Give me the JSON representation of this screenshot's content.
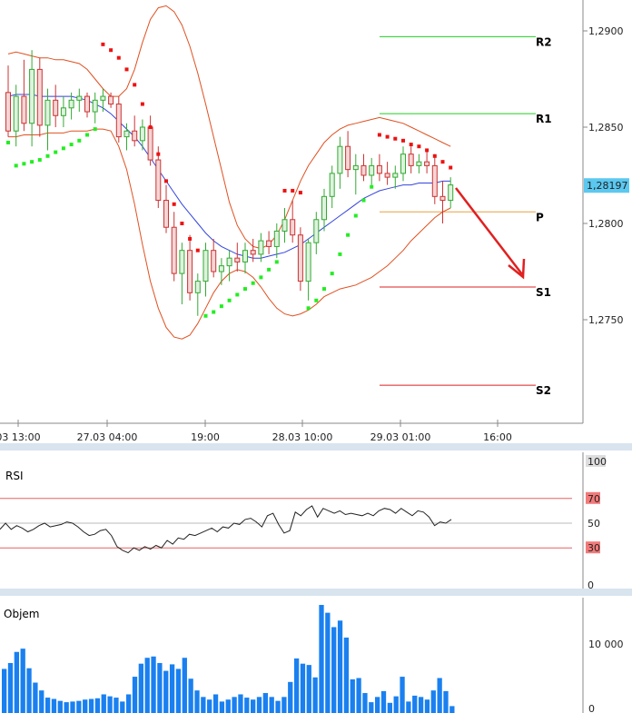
{
  "chart_data": [
    {
      "type": "candlestick",
      "x_tick_labels": [
        "03 13:00",
        "27.03 04:00",
        "19:00",
        "28.03 10:00",
        "29.03 01:00",
        "16:00"
      ],
      "y_tick_labels": [
        "1,2900",
        "1,2850",
        "1,2800",
        "1,2750"
      ],
      "ylim": [
        1.27,
        1.292
      ],
      "current_price_label": "1,28197",
      "current_price": 1.28197,
      "pivot_levels": [
        {
          "label": "R2",
          "value": 1.2897,
          "color": "#22cc22"
        },
        {
          "label": "R1",
          "value": 1.2857,
          "color": "#22cc22"
        },
        {
          "label": "P",
          "value": 1.2806,
          "color": "#e8a040"
        },
        {
          "label": "S1",
          "value": 1.2767,
          "color": "#dd2222"
        },
        {
          "label": "S2",
          "value": 1.2716,
          "color": "#dd2222"
        }
      ],
      "candles": [
        [
          1.2868,
          1.2882,
          1.2845,
          1.2848
        ],
        [
          1.2848,
          1.2872,
          1.284,
          1.2866
        ],
        [
          1.2866,
          1.2885,
          1.2848,
          1.2852
        ],
        [
          1.2852,
          1.289,
          1.284,
          1.288
        ],
        [
          1.288,
          1.2886,
          1.2845,
          1.2851
        ],
        [
          1.2851,
          1.287,
          1.2838,
          1.2864
        ],
        [
          1.2864,
          1.2872,
          1.285,
          1.2856
        ],
        [
          1.2856,
          1.2866,
          1.285,
          1.286
        ],
        [
          1.286,
          1.2868,
          1.2854,
          1.2864
        ],
        [
          1.2864,
          1.287,
          1.2858,
          1.2866
        ],
        [
          1.2866,
          1.2868,
          1.2855,
          1.2858
        ],
        [
          1.2858,
          1.2868,
          1.2852,
          1.2864
        ],
        [
          1.2864,
          1.287,
          1.2858,
          1.2866
        ],
        [
          1.2866,
          1.2868,
          1.286,
          1.2862
        ],
        [
          1.2862,
          1.2866,
          1.2842,
          1.2845
        ],
        [
          1.2845,
          1.2852,
          1.2838,
          1.2848
        ],
        [
          1.2848,
          1.2856,
          1.284,
          1.2843
        ],
        [
          1.2843,
          1.2854,
          1.2838,
          1.285
        ],
        [
          1.285,
          1.2856,
          1.283,
          1.2833
        ],
        [
          1.2833,
          1.284,
          1.2808,
          1.2812
        ],
        [
          1.2812,
          1.282,
          1.2795,
          1.2798
        ],
        [
          1.2798,
          1.2806,
          1.277,
          1.2774
        ],
        [
          1.2774,
          1.279,
          1.2758,
          1.2786
        ],
        [
          1.2786,
          1.2794,
          1.276,
          1.2764
        ],
        [
          1.2764,
          1.2774,
          1.2752,
          1.277
        ],
        [
          1.277,
          1.279,
          1.2762,
          1.2786
        ],
        [
          1.2786,
          1.2792,
          1.2772,
          1.2775
        ],
        [
          1.2775,
          1.2782,
          1.2768,
          1.2778
        ],
        [
          1.2778,
          1.2786,
          1.277,
          1.2782
        ],
        [
          1.2782,
          1.279,
          1.2775,
          1.278
        ],
        [
          1.278,
          1.279,
          1.2774,
          1.2786
        ],
        [
          1.2786,
          1.2792,
          1.278,
          1.2784
        ],
        [
          1.2784,
          1.2795,
          1.278,
          1.2791
        ],
        [
          1.2791,
          1.2796,
          1.2784,
          1.2788
        ],
        [
          1.2788,
          1.28,
          1.2782,
          1.2796
        ],
        [
          1.2796,
          1.2808,
          1.279,
          1.2802
        ],
        [
          1.2802,
          1.2812,
          1.279,
          1.2794
        ],
        [
          1.2794,
          1.2798,
          1.2765,
          1.277
        ],
        [
          1.277,
          1.2792,
          1.276,
          1.279
        ],
        [
          1.279,
          1.2806,
          1.2784,
          1.2802
        ],
        [
          1.2802,
          1.2818,
          1.2796,
          1.2814
        ],
        [
          1.2814,
          1.283,
          1.2808,
          1.2826
        ],
        [
          1.2826,
          1.2845,
          1.2818,
          1.284
        ],
        [
          1.284,
          1.2848,
          1.2824,
          1.2828
        ],
        [
          1.2828,
          1.2836,
          1.2815,
          1.283
        ],
        [
          1.283,
          1.2836,
          1.2822,
          1.2825
        ],
        [
          1.2825,
          1.2834,
          1.282,
          1.283
        ],
        [
          1.283,
          1.2836,
          1.2822,
          1.2826
        ],
        [
          1.2826,
          1.2832,
          1.282,
          1.2824
        ],
        [
          1.2824,
          1.283,
          1.2818,
          1.2826
        ],
        [
          1.2826,
          1.284,
          1.2822,
          1.2836
        ],
        [
          1.2836,
          1.284,
          1.2826,
          1.283
        ],
        [
          1.283,
          1.2836,
          1.2826,
          1.2832
        ],
        [
          1.2832,
          1.2838,
          1.2826,
          1.283
        ],
        [
          1.283,
          1.2836,
          1.281,
          1.2814
        ],
        [
          1.2814,
          1.2822,
          1.28,
          1.2812
        ],
        [
          1.2812,
          1.2824,
          1.2808,
          1.282
        ]
      ],
      "bollinger_upper": [
        1.2888,
        1.2889,
        1.2888,
        1.2887,
        1.2886,
        1.2886,
        1.2885,
        1.2885,
        1.2884,
        1.2883,
        1.288,
        1.2875,
        1.287,
        1.2866,
        1.2866,
        1.287,
        1.288,
        1.2894,
        1.2906,
        1.2912,
        1.2913,
        1.291,
        1.2903,
        1.2892,
        1.2878,
        1.2862,
        1.2845,
        1.2828,
        1.2811,
        1.2799,
        1.2792,
        1.2788,
        1.2787,
        1.2789,
        1.2794,
        1.2802,
        1.2812,
        1.2822,
        1.283,
        1.2836,
        1.2842,
        1.2846,
        1.2849,
        1.2851,
        1.2852,
        1.2853,
        1.2854,
        1.2855,
        1.2854,
        1.2853,
        1.2852,
        1.285,
        1.2848,
        1.2846,
        1.2844,
        1.2842,
        1.284
      ],
      "bollinger_mid": [
        1.2866,
        1.2867,
        1.2867,
        1.2867,
        1.2866,
        1.2866,
        1.2866,
        1.2866,
        1.2866,
        1.2865,
        1.2864,
        1.2862,
        1.286,
        1.2857,
        1.2853,
        1.2849,
        1.2845,
        1.284,
        1.2834,
        1.2828,
        1.2822,
        1.2816,
        1.281,
        1.2805,
        1.28,
        1.2795,
        1.2791,
        1.2788,
        1.2786,
        1.2784,
        1.2783,
        1.2782,
        1.2782,
        1.2783,
        1.2784,
        1.2785,
        1.2787,
        1.2789,
        1.2792,
        1.2795,
        1.2798,
        1.2801,
        1.2804,
        1.2807,
        1.281,
        1.2813,
        1.2815,
        1.2817,
        1.2818,
        1.2819,
        1.282,
        1.282,
        1.2821,
        1.2821,
        1.2821,
        1.2822,
        1.2822
      ],
      "bollinger_lower": [
        1.2845,
        1.2845,
        1.2846,
        1.2846,
        1.2846,
        1.2847,
        1.2847,
        1.2847,
        1.2848,
        1.2848,
        1.2848,
        1.2849,
        1.2849,
        1.2848,
        1.284,
        1.2828,
        1.281,
        1.2789,
        1.277,
        1.2756,
        1.2746,
        1.2741,
        1.274,
        1.2742,
        1.2748,
        1.2756,
        1.2764,
        1.277,
        1.2774,
        1.2776,
        1.2775,
        1.2772,
        1.2767,
        1.2761,
        1.2756,
        1.2753,
        1.2752,
        1.2753,
        1.2755,
        1.2758,
        1.2762,
        1.2764,
        1.2766,
        1.2767,
        1.2768,
        1.277,
        1.2772,
        1.2775,
        1.2778,
        1.2782,
        1.2786,
        1.2791,
        1.2795,
        1.2799,
        1.2803,
        1.2806,
        1.2808
      ],
      "parabolic_sar": [
        {
          "i": 0,
          "v": 1.2842,
          "side": "below"
        },
        {
          "i": 1,
          "v": 1.283,
          "side": "below"
        },
        {
          "i": 2,
          "v": 1.2831,
          "side": "below"
        },
        {
          "i": 3,
          "v": 1.2832,
          "side": "below"
        },
        {
          "i": 4,
          "v": 1.2833,
          "side": "below"
        },
        {
          "i": 5,
          "v": 1.2835,
          "side": "below"
        },
        {
          "i": 6,
          "v": 1.2837,
          "side": "below"
        },
        {
          "i": 7,
          "v": 1.2839,
          "side": "below"
        },
        {
          "i": 8,
          "v": 1.2841,
          "side": "below"
        },
        {
          "i": 9,
          "v": 1.2843,
          "side": "below"
        },
        {
          "i": 10,
          "v": 1.2846,
          "side": "below"
        },
        {
          "i": 11,
          "v": 1.2849,
          "side": "below"
        },
        {
          "i": 12,
          "v": 1.2893,
          "side": "above"
        },
        {
          "i": 13,
          "v": 1.289,
          "side": "above"
        },
        {
          "i": 14,
          "v": 1.2886,
          "side": "above"
        },
        {
          "i": 15,
          "v": 1.288,
          "side": "above"
        },
        {
          "i": 16,
          "v": 1.2872,
          "side": "above"
        },
        {
          "i": 17,
          "v": 1.2862,
          "side": "above"
        },
        {
          "i": 18,
          "v": 1.285,
          "side": "above"
        },
        {
          "i": 19,
          "v": 1.2836,
          "side": "above"
        },
        {
          "i": 20,
          "v": 1.2822,
          "side": "above"
        },
        {
          "i": 21,
          "v": 1.281,
          "side": "above"
        },
        {
          "i": 22,
          "v": 1.28,
          "side": "above"
        },
        {
          "i": 23,
          "v": 1.2792,
          "side": "above"
        },
        {
          "i": 24,
          "v": 1.2786,
          "side": "above"
        },
        {
          "i": 25,
          "v": 1.2752,
          "side": "below"
        },
        {
          "i": 26,
          "v": 1.2754,
          "side": "below"
        },
        {
          "i": 27,
          "v": 1.2757,
          "side": "below"
        },
        {
          "i": 28,
          "v": 1.276,
          "side": "below"
        },
        {
          "i": 29,
          "v": 1.2763,
          "side": "below"
        },
        {
          "i": 30,
          "v": 1.2766,
          "side": "below"
        },
        {
          "i": 31,
          "v": 1.2769,
          "side": "below"
        },
        {
          "i": 32,
          "v": 1.2772,
          "side": "below"
        },
        {
          "i": 33,
          "v": 1.2776,
          "side": "below"
        },
        {
          "i": 34,
          "v": 1.278,
          "side": "below"
        },
        {
          "i": 35,
          "v": 1.2817,
          "side": "above"
        },
        {
          "i": 36,
          "v": 1.2817,
          "side": "above"
        },
        {
          "i": 37,
          "v": 1.2816,
          "side": "above"
        },
        {
          "i": 38,
          "v": 1.2756,
          "side": "below"
        },
        {
          "i": 39,
          "v": 1.276,
          "side": "below"
        },
        {
          "i": 40,
          "v": 1.2766,
          "side": "below"
        },
        {
          "i": 41,
          "v": 1.2774,
          "side": "below"
        },
        {
          "i": 42,
          "v": 1.2784,
          "side": "below"
        },
        {
          "i": 43,
          "v": 1.2794,
          "side": "below"
        },
        {
          "i": 44,
          "v": 1.2804,
          "side": "below"
        },
        {
          "i": 45,
          "v": 1.2812,
          "side": "below"
        },
        {
          "i": 46,
          "v": 1.2819,
          "side": "below"
        },
        {
          "i": 47,
          "v": 1.2846,
          "side": "above"
        },
        {
          "i": 48,
          "v": 1.2845,
          "side": "above"
        },
        {
          "i": 49,
          "v": 1.2844,
          "side": "above"
        },
        {
          "i": 50,
          "v": 1.2843,
          "side": "above"
        },
        {
          "i": 51,
          "v": 1.2841,
          "side": "above"
        },
        {
          "i": 52,
          "v": 1.284,
          "side": "above"
        },
        {
          "i": 53,
          "v": 1.2838,
          "side": "above"
        },
        {
          "i": 54,
          "v": 1.2835,
          "side": "above"
        },
        {
          "i": 55,
          "v": 1.2832,
          "side": "above"
        },
        {
          "i": 56,
          "v": 1.2829,
          "side": "above"
        }
      ],
      "colors": {
        "bull": "#33aa33",
        "bear": "#cc3333",
        "band": "#e05020",
        "mid": "#3344dd",
        "sar_up": "#22ee22",
        "sar_down": "#ee1111",
        "arrow": "#e02020",
        "price_badge": "#5bc8f0"
      }
    },
    {
      "type": "line",
      "title": "RSI",
      "ylim": [
        0,
        100
      ],
      "y_tick_labels": [
        "100",
        "70",
        "50",
        "30",
        "0"
      ],
      "levels": [
        70,
        30
      ],
      "values": [
        45,
        50,
        45,
        48,
        46,
        43,
        45,
        48,
        50,
        47,
        48,
        49,
        51,
        50,
        47,
        43,
        40,
        41,
        44,
        45,
        40,
        31,
        28,
        26,
        30,
        28,
        31,
        29,
        32,
        30,
        36,
        33,
        38,
        37,
        41,
        40,
        42,
        44,
        46,
        43,
        47,
        46,
        50,
        49,
        53,
        54,
        51,
        47,
        56,
        58,
        49,
        42,
        44,
        59,
        56,
        61,
        64,
        55,
        62,
        60,
        58,
        60,
        57,
        58,
        57,
        56,
        58,
        56,
        60,
        62,
        61,
        58,
        62,
        59,
        56,
        60,
        59,
        55,
        48,
        51,
        50,
        53
      ]
    },
    {
      "type": "bar",
      "title": "Objem",
      "ylim": [
        0,
        16000
      ],
      "y_tick_labels": [
        "10 000",
        "0"
      ],
      "values": [
        6200,
        7100,
        8800,
        9300,
        6300,
        4100,
        2900,
        1800,
        1600,
        1300,
        1100,
        1200,
        1300,
        1500,
        1600,
        1700,
        2300,
        2000,
        1800,
        1200,
        2300,
        5000,
        7000,
        7900,
        8100,
        7100,
        5900,
        6900,
        6200,
        7900,
        4700,
        2900,
        1900,
        1500,
        2300,
        1200,
        1500,
        1900,
        2300,
        1800,
        1500,
        1900,
        2500,
        1900,
        1300,
        1900,
        4200,
        7800,
        7000,
        6800,
        4900,
        16000,
        14800,
        12600,
        13600,
        11000,
        4600,
        4800,
        2500,
        1100,
        1900,
        2800,
        1000,
        2000,
        5000,
        1200,
        2100,
        1900,
        1500,
        2900,
        4800,
        2800,
        500
      ],
      "color": "#1a80f0"
    }
  ]
}
